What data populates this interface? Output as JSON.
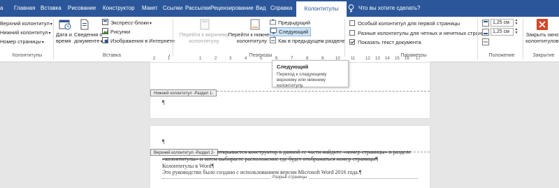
{
  "tabs": [
    {
      "label": "Главная",
      "active": false
    },
    {
      "label": "Вставка",
      "active": false
    },
    {
      "label": "Рисование",
      "active": false
    },
    {
      "label": "Конструктор",
      "active": false
    },
    {
      "label": "Макет",
      "active": false
    },
    {
      "label": "Ссылки",
      "active": false
    },
    {
      "label": "Рассылки",
      "active": false
    },
    {
      "label": "Рецензирование",
      "active": false
    },
    {
      "label": "Вид",
      "active": false
    },
    {
      "label": "Справка",
      "active": false
    },
    {
      "label": "Колонтитулы",
      "active": true
    }
  ],
  "tabs_partial_first": "а",
  "tell_me": "Что вы хотите сделать?",
  "ribbon": {
    "hf_group": {
      "header": "Верхний колонтитул",
      "footer": "Нижний колонтитул",
      "page_number": "Номер страницы",
      "label": "Колонтитулы"
    },
    "insert_group": {
      "date_time": [
        "Дата и",
        "время"
      ],
      "doc_info": [
        "Сведения о",
        "документе"
      ],
      "quick_parts": "Экспресс-блоки",
      "pictures": "Рисунки",
      "online_pictures": "Изображения в Интернете",
      "label": "Вставка"
    },
    "nav_group": {
      "goto_header": [
        "Перейти к верхнему",
        "колонтитулу"
      ],
      "goto_footer": [
        "Перейти к нижнему",
        "колонтитулу"
      ],
      "previous": "Предыдущий",
      "next": "Следующий",
      "link_previous": "Как в предыдущем разделе",
      "label": "Переходы"
    },
    "options_group": {
      "different_first": "Особый колонтитул для первой страницы",
      "different_odd_even": "Разные колонтитулы для четных и нечетных страниц",
      "show_text": "Показать текст документа",
      "different_first_checked": false,
      "different_odd_even_checked": false,
      "show_text_checked": true,
      "label": "Параметры"
    },
    "position_group": {
      "header_from_top": "1,25 см",
      "footer_from_bottom": "1,25 см",
      "label": "Положение"
    },
    "close_group": {
      "close": [
        "Закрыть окно",
        "колонтитулов"
      ],
      "label": "Закрытие"
    }
  },
  "ruler_numbers": [
    "2",
    "1",
    "1",
    "2",
    "3",
    "4",
    "5",
    "6",
    "7",
    "8",
    "9",
    "10",
    "11",
    "12",
    "13",
    "14",
    "15",
    "16",
    "17"
  ],
  "tooltip": {
    "title": "Следующий",
    "body": [
      "Переход к следующему",
      "верхнему или нижнему",
      "колонтитулу."
    ]
  },
  "document": {
    "footer_tag": "Нижний колонтитул -Раздел 1-",
    "header_tag": "Верхний колонтитул -Раздел 2-",
    "pilcrow": "¶",
    "page2_lines": [
      "открывается конструктор в данной ее части найдите «номер страницы» в разделе",
      "«колонтитулы» и затем выбираете расположение где будет отображаться номер страницы¶",
      "Колонтитулы в Word¶",
      "Это руководство было создано с использованием версии Microsoft Word 2016 года.¶"
    ],
    "page_break": "Разрыв страницы"
  },
  "colors": {
    "tab_bar": "#2b579a",
    "ribbon_bg": "#ffffff",
    "doc_bg": "#e6e6e6",
    "close_icon": "#d24726"
  }
}
